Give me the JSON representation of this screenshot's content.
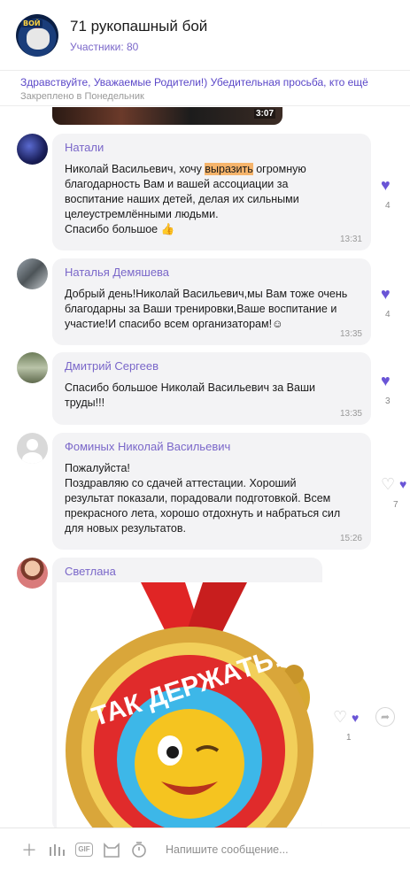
{
  "header": {
    "title": "71 рукопашный бой",
    "members": "Участники: 80",
    "avatar_badge": "ВОЙ"
  },
  "pinned": {
    "text": "Здравствуйте, Уважаемые Родители!) Убедительная просьба, кто ещё",
    "sub": "Закреплено в Понедельник"
  },
  "video": {
    "duration": "3:07"
  },
  "messages": [
    {
      "author": "Натали",
      "text_before": "Николай Васильевич, хочу ",
      "text_highlight": "выразить",
      "text_after": " огромную\nблагодарность Вам и вашей ассоциации за\nвоспитание наших детей, делая их сильными\nцелеустремлёнными людьми.\nСпасибо большое 👍",
      "time": "13:31",
      "likes": "4"
    },
    {
      "author": "Наталья Демяшева",
      "text": "Добрый день!Николай Васильевич,мы Вам тоже очень\nблагодарны за Ваши тренировки,Ваше воспитание и\nучастие!И спасибо всем организаторам!☺",
      "time": "13:35",
      "likes": "4"
    },
    {
      "author": "Дмитрий Сергеев",
      "text": "Спасибо большое Николай Васильевич за Ваши\nтруды!!!",
      "time": "13:35",
      "likes": "3"
    },
    {
      "author": "Фоминых Николай Васильевич",
      "text": "Пожалуйста!\n Поздравляю со сдачей аттестации. Хороший\nрезультат показали, порадовали подготовкой. Всем\nпрекрасного лета, хорошо отдохнуть и набраться сил\nдля новых результатов.",
      "time": "15:26",
      "likes": "7"
    },
    {
      "author": "Светлана",
      "image_text": "ТАК ДЕРЖАТЬ!",
      "likes": "1"
    }
  ],
  "composer": {
    "placeholder": "Напишите сообщение...",
    "gif_label": "GIF"
  },
  "icons": {
    "like": "heart-icon",
    "share": "share-icon",
    "attach": "plus-icon",
    "voice": "voice-icon",
    "sticker": "cat-sticker-icon",
    "timer": "timer-icon"
  },
  "colors": {
    "accent": "#7a67c9",
    "heart": "#6a55d6",
    "highlight": "#f6b46b",
    "bubble": "#f3f3f5"
  }
}
